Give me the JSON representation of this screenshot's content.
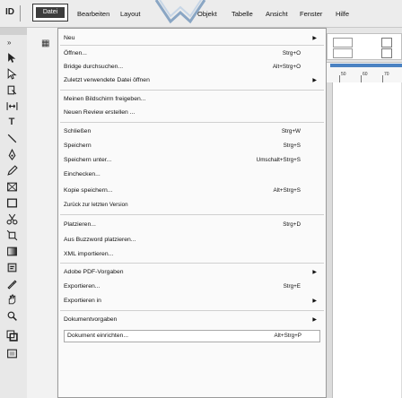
{
  "menubar": {
    "app_logo": "ID",
    "items": {
      "datei": "Datei",
      "bearbeiten": "Bearbeiten",
      "layout": "Layout",
      "objekt": "Objekt",
      "tabelle": "Tabelle",
      "ansicht": "Ansicht",
      "fenster": "Fenster",
      "hilfe": "Hilfe"
    }
  },
  "menu": {
    "items": [
      {
        "label": "Neu",
        "shortcut": "",
        "submenu": true
      },
      {
        "label": "Öffnen...",
        "shortcut": "Strg+O",
        "submenu": false
      },
      {
        "label": "Bridge durchsuchen...",
        "shortcut": "Alt+Strg+O",
        "submenu": false
      },
      {
        "label": "Zuletzt verwendete Datei öffnen",
        "shortcut": "",
        "submenu": true
      },
      {
        "label": "Meinen Bildschirm freigeben...",
        "shortcut": "",
        "submenu": false
      },
      {
        "label": "Neuen Review erstellen ...",
        "shortcut": "",
        "submenu": false
      },
      {
        "label": "Schließen",
        "shortcut": "Strg+W",
        "submenu": false
      },
      {
        "label": "Speichern",
        "shortcut": "Strg+S",
        "submenu": false
      },
      {
        "label": "Speichern unter...",
        "shortcut": "Umschalt+Strg+S",
        "submenu": false
      },
      {
        "label": "Einchecken...",
        "shortcut": "",
        "submenu": false
      },
      {
        "label": "Kopie speichern...",
        "shortcut": "Alt+Strg+S",
        "submenu": false
      },
      {
        "label": "Zurück zur letzten Version",
        "shortcut": "",
        "submenu": false
      },
      {
        "label": "Platzieren...",
        "shortcut": "Strg+D",
        "submenu": false
      },
      {
        "label": "Aus Buzzword platzieren...",
        "shortcut": "",
        "submenu": false
      },
      {
        "label": "XML importieren...",
        "shortcut": "",
        "submenu": false
      },
      {
        "label": "Adobe PDF-Vorgaben",
        "shortcut": "",
        "submenu": true
      },
      {
        "label": "Exportieren...",
        "shortcut": "Strg+E",
        "submenu": false
      },
      {
        "label": "Exportieren in",
        "shortcut": "",
        "submenu": true
      },
      {
        "label": "Dokumentvorgaben",
        "shortcut": "",
        "submenu": true
      },
      {
        "label": "Dokument einrichten...",
        "shortcut": "Alt+Strg+P",
        "submenu": false
      }
    ]
  },
  "ruler": {
    "numbers": [
      "50",
      "60",
      "70"
    ]
  },
  "colors": {
    "accent": "#4a82c2",
    "menu_bg": "#fafafa",
    "selected_menu": "#3c3c3c"
  },
  "icons": {
    "tools": [
      "selection-tool-icon",
      "direct-selection-tool-icon",
      "page-tool-icon",
      "gap-tool-icon",
      "type-tool-icon",
      "line-tool-icon",
      "pen-tool-icon",
      "pencil-tool-icon",
      "rectangle-frame-tool-icon",
      "rectangle-tool-icon",
      "scissors-tool-icon",
      "free-transform-tool-icon",
      "gradient-tool-icon",
      "note-tool-icon",
      "eyedropper-tool-icon",
      "hand-tool-icon",
      "zoom-tool-icon"
    ]
  }
}
